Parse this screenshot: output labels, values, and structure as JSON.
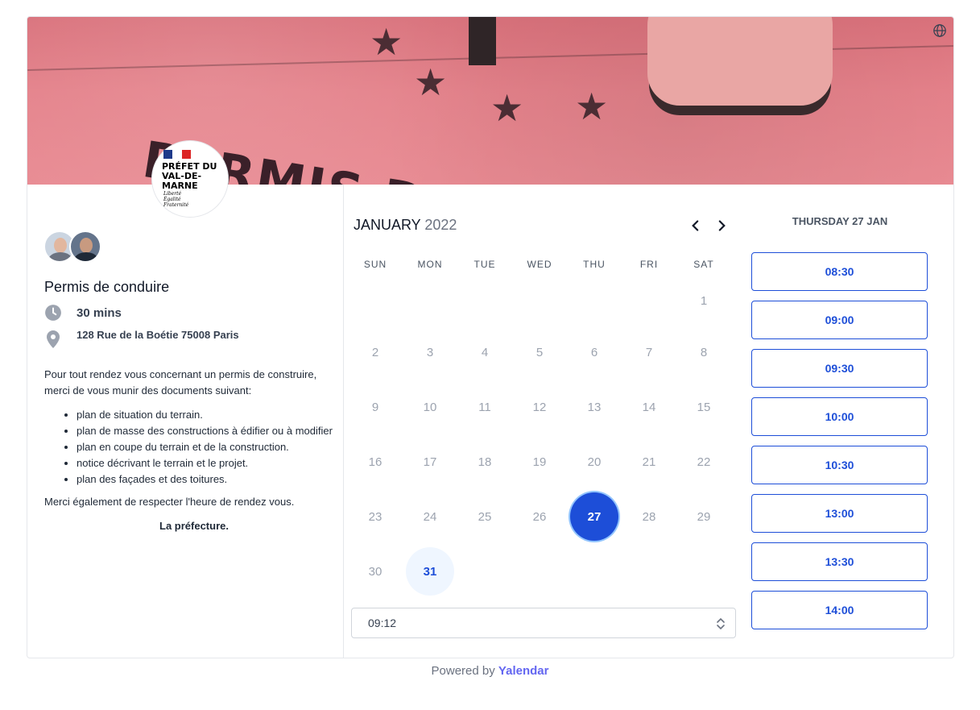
{
  "banner": {
    "language_icon": "globe-icon",
    "image_text": "PERMIS DE C"
  },
  "logo": {
    "name": "PRÉFET DU VAL-DE-MARNE",
    "motto": [
      "Liberté",
      "Égalité",
      "Fraternité"
    ]
  },
  "event": {
    "title": "Permis de conduire",
    "duration": "30 mins",
    "address": "128 Rue de la Boétie 75008 Paris",
    "intro": "Pour tout rendez vous concernant un permis de construire, merci de vous munir des documents suivant:",
    "documents": [
      "plan de situation du terrain.",
      "plan de masse des constructions à édifier ou à modifier",
      "plan en coupe du terrain et de la construction.",
      "notice décrivant le terrain et le projet.",
      "plan des façades et des toitures."
    ],
    "closing": "Merci également de respecter l'heure de rendez vous.",
    "signoff": "La préfecture."
  },
  "calendar": {
    "month": "JANUARY",
    "year": "2022",
    "weekdays": [
      "SUN",
      "MON",
      "TUE",
      "WED",
      "THU",
      "FRI",
      "SAT"
    ],
    "first_weekday_index": 6,
    "days_in_month": 31,
    "selected_day": 27,
    "available_days": [
      27,
      31
    ],
    "timezone_value": "09:12"
  },
  "slots": {
    "date_label": "THURSDAY 27 JAN",
    "times": [
      "08:30",
      "09:00",
      "09:30",
      "10:00",
      "10:30",
      "13:00",
      "13:30",
      "14:00"
    ]
  },
  "footer": {
    "powered_prefix": "Powered by",
    "brand": "Yalendar"
  },
  "colors": {
    "primary": "#1d4ed8",
    "available_bg": "#eff6ff",
    "brand": "#6366f1"
  }
}
